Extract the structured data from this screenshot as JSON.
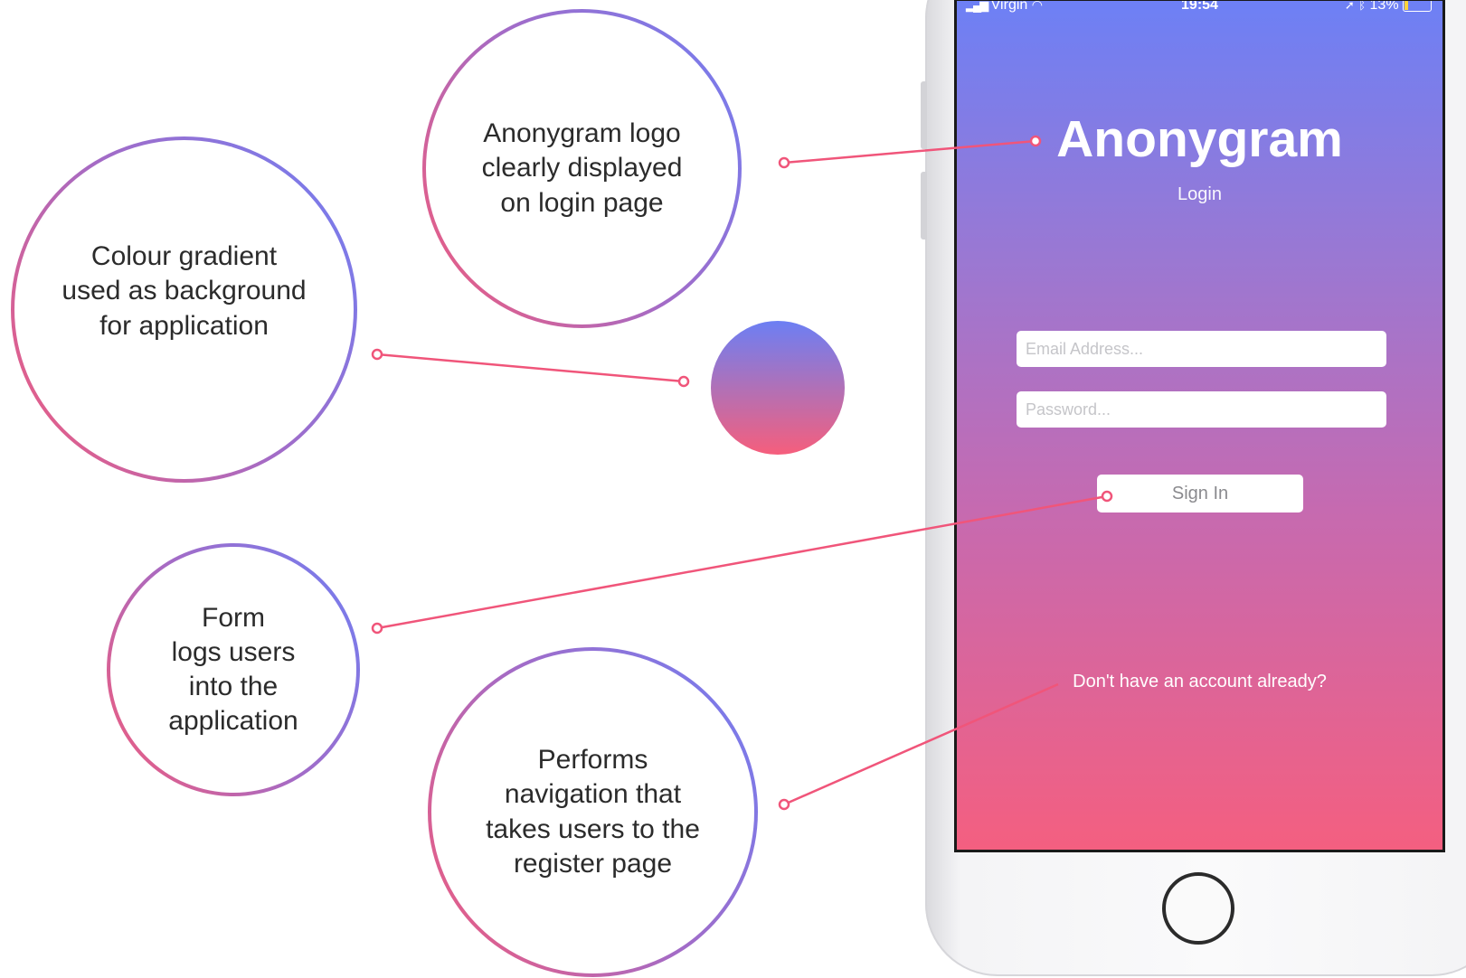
{
  "annotations": {
    "logo_note": "Anonygram logo\nclearly displayed\non login page",
    "gradient_note": "Colour gradient\nused as background\nfor application",
    "form_note": "Form\nlogs users\ninto the\napplication",
    "nav_note": "Performs\nnavigation that\ntakes users to the\nregister page"
  },
  "status_bar": {
    "carrier": "Virgin",
    "time": "19:54",
    "battery": "13%"
  },
  "app": {
    "title": "Anonygram",
    "subtitle": "Login",
    "email_placeholder": "Email Address...",
    "password_placeholder": "Password...",
    "sign_in_label": "Sign In",
    "register_link": "Don't have an account already?"
  },
  "colors": {
    "gradient_top": "#6d80f5",
    "gradient_bottom": "#f45f80",
    "connector": "#f0557a"
  },
  "icons": [
    "signal-icon",
    "wifi-icon",
    "location-icon",
    "bluetooth-icon",
    "battery-icon"
  ]
}
